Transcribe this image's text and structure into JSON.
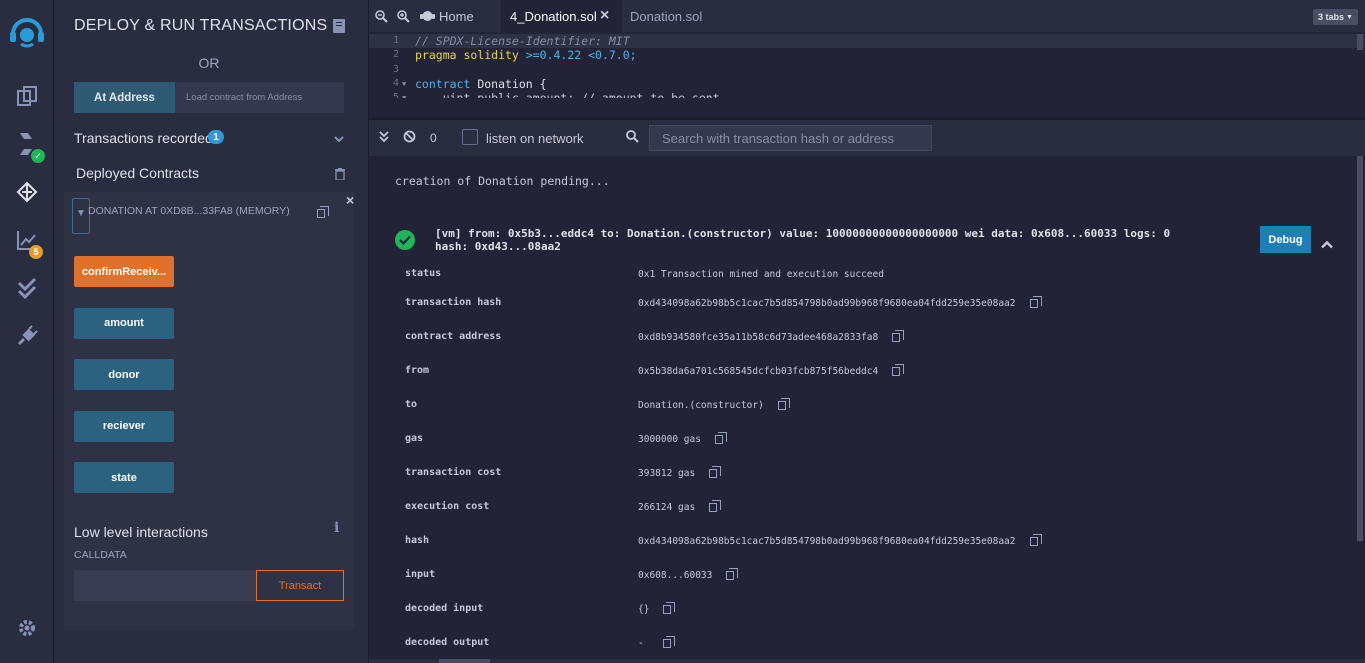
{
  "panel": {
    "title": "DEPLOY & RUN TRANSACTIONS",
    "or": "OR",
    "at_address_button": "At Address",
    "load_contract_placeholder": "Load contract from Address",
    "transactions_recorded": "Transactions recorded",
    "transactions_recorded_count": "1",
    "deployed_contracts": "Deployed Contracts",
    "instance_title": "DONATION AT 0XD8B...33FA8 (MEMORY)",
    "functions": [
      {
        "label": "confirmReceiv...",
        "kind": "orange"
      },
      {
        "label": "amount",
        "kind": "blue"
      },
      {
        "label": "donor",
        "kind": "blue"
      },
      {
        "label": "reciever",
        "kind": "blue"
      },
      {
        "label": "state",
        "kind": "blue"
      }
    ],
    "low_level": "Low level interactions",
    "calldata": "CALLDATA",
    "transact": "Transact"
  },
  "rail": {
    "badge_deploy": "",
    "badge_analysis": "5"
  },
  "editor": {
    "tabs": [
      "Home",
      "4_Donation.sol",
      "Donation.sol"
    ],
    "active_tab": "4_Donation.sol",
    "tabs_count": "3 tabs",
    "lines": [
      {
        "n": "1",
        "text": "// SPDX-License-Identifier: MIT"
      },
      {
        "n": "2",
        "text": "pragma solidity >=0.4.22 <0.7.0;"
      },
      {
        "n": "3",
        "text": ""
      },
      {
        "n": "4",
        "text": "contract Donation {"
      },
      {
        "n": "5",
        "text": "    uint public amount; // amount to be sent"
      }
    ]
  },
  "terminal": {
    "pending_count": "0",
    "listen_label": "listen on network",
    "search_placeholder": "Search with transaction hash or address",
    "pending_msg": "creation of Donation pending...",
    "tx_summary_1": "[vm]  from: 0x5b3...eddc4 to: Donation.(constructor) value: 10000000000000000000 wei data: 0x608...60033 logs: 0",
    "tx_summary_2": "hash: 0xd43...08aa2",
    "debug": "Debug",
    "details": [
      {
        "key": "status",
        "value": "0x1 Transaction mined and execution succeed",
        "copy": false
      },
      {
        "key": "transaction hash",
        "value": "0xd434098a62b98b5c1cac7b5d854798b0ad99b968f9680ea04fdd259e35e08aa2",
        "copy": true
      },
      {
        "key": "contract address",
        "value": "0xd8b934580fce35a11b58c6d73adee468a2833fa8",
        "copy": true
      },
      {
        "key": "from",
        "value": "0x5b38da6a701c568545dcfcb03fcb875f56beddc4",
        "copy": true
      },
      {
        "key": "to",
        "value": "Donation.(constructor)",
        "copy": true
      },
      {
        "key": "gas",
        "value": "3000000 gas",
        "copy": true
      },
      {
        "key": "transaction cost",
        "value": "393812 gas",
        "copy": true
      },
      {
        "key": "execution cost",
        "value": "266124 gas",
        "copy": true
      },
      {
        "key": "hash",
        "value": "0xd434098a62b98b5c1cac7b5d854798b0ad99b968f9680ea04fdd259e35e08aa2",
        "copy": true
      },
      {
        "key": "input",
        "value": "0x608...60033",
        "copy": true
      },
      {
        "key": "decoded input",
        "value": "{}",
        "copy": true
      },
      {
        "key": "decoded output",
        "value": " - ",
        "copy": true
      }
    ]
  },
  "colors": {
    "accent_blue": "#2a6280",
    "accent_orange": "#e0712c",
    "success_green": "#1fb65a",
    "debug_blue": "#1f7fb5"
  }
}
